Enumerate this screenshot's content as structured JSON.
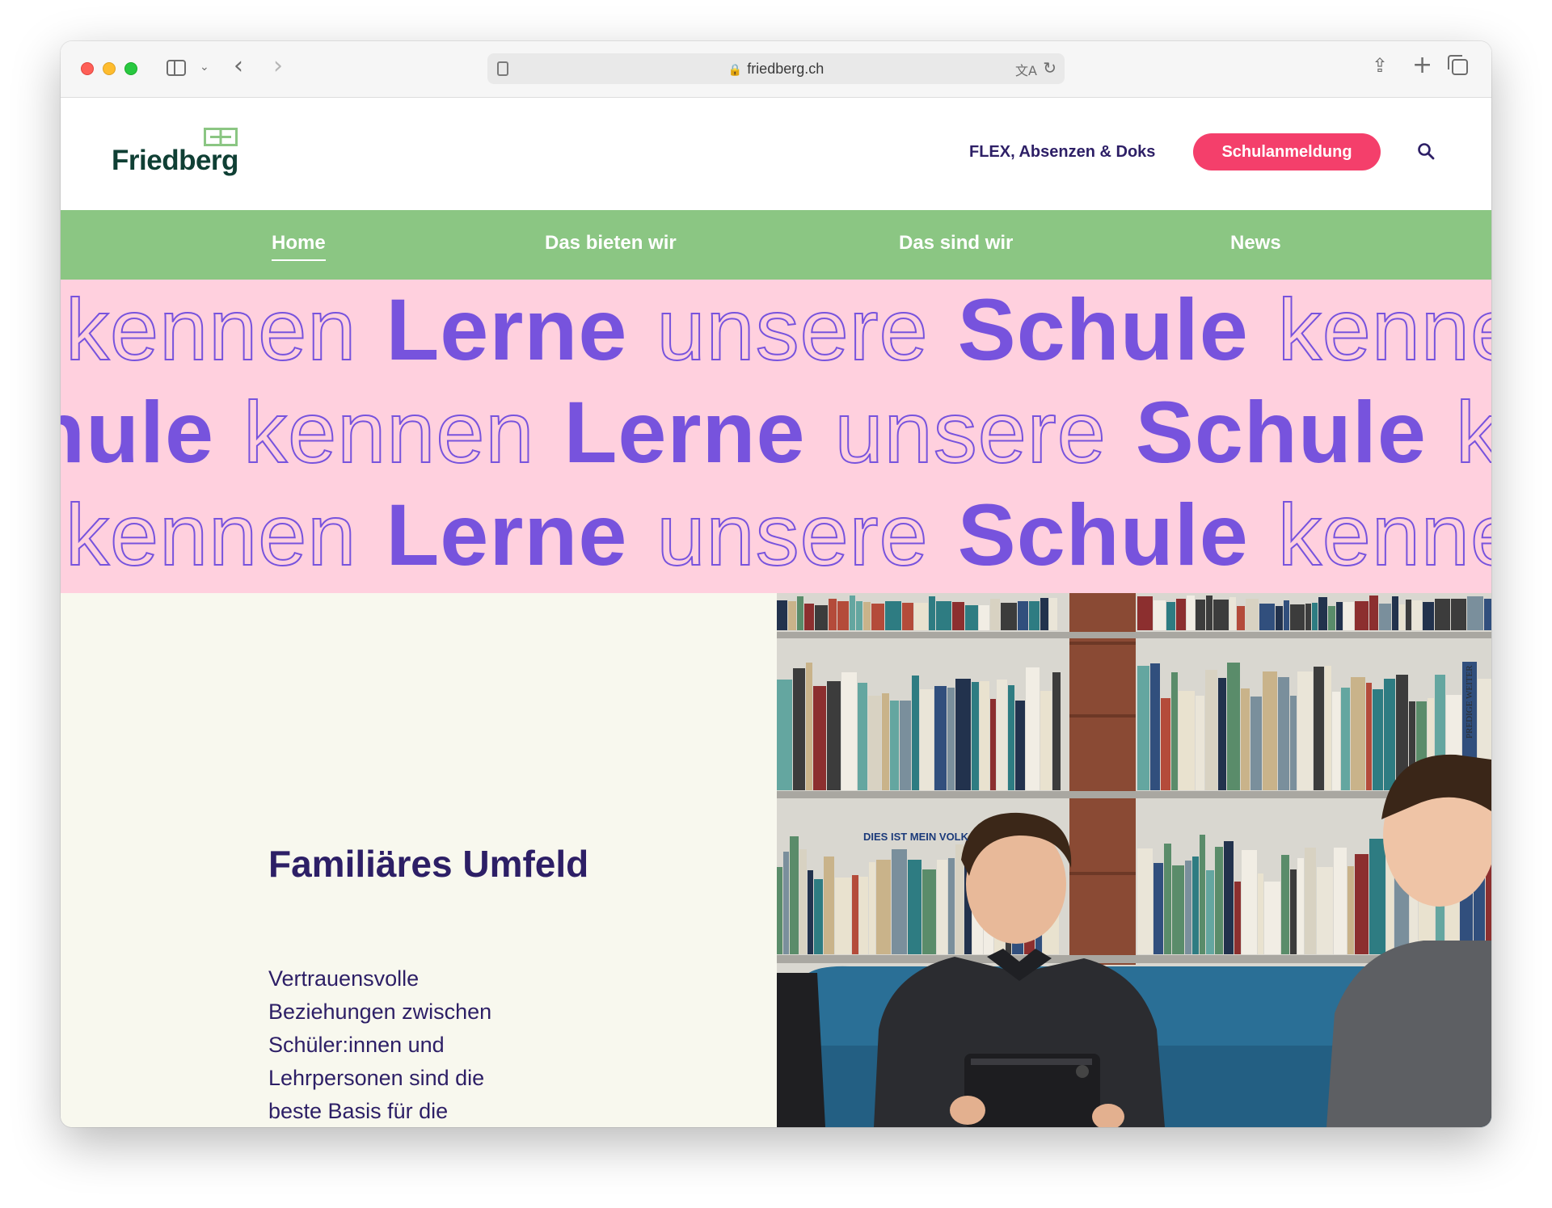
{
  "browser": {
    "url": "friedberg.ch"
  },
  "header": {
    "logo_text": "Friedberg",
    "meta_link": "FLEX, Absenzen & Doks",
    "cta_label": "Schulanmeldung"
  },
  "nav": {
    "items": [
      {
        "label": "Home",
        "active": true
      },
      {
        "label": "Das bieten wir",
        "active": false
      },
      {
        "label": "Das sind wir",
        "active": false
      },
      {
        "label": "News",
        "active": false
      }
    ]
  },
  "hero": {
    "word_lerne": "Lerne",
    "word_unsere": "unsere",
    "word_schule": "Schule",
    "word_kennen": "kennen",
    "colors": {
      "background": "#ffd0de",
      "text": "#7753dd"
    }
  },
  "feature": {
    "title": "Familiäres Umfeld",
    "text": "Vertrauensvolle Beziehungen zwischen Schüler:innen und Lehrpersonen sind die beste Basis für die"
  },
  "photo": {
    "book_title_1": "DIES IST MEIN VOLK",
    "book_title_2": "PREDIGE WEITER"
  },
  "colors": {
    "nav": "#8bc683",
    "cta": "#f43f6b",
    "text_dark": "#2d1f66",
    "content_bg": "#f8f8ee"
  }
}
